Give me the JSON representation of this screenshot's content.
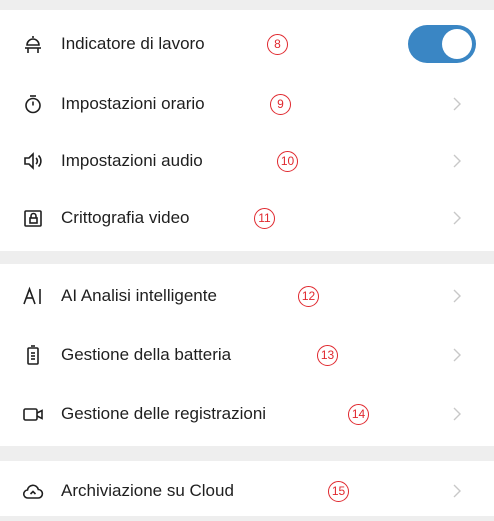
{
  "colors": {
    "accent": "#3a86c4",
    "annotation": "#e0282e",
    "section_gap": "#eeeeee"
  },
  "groups": [
    {
      "items": [
        {
          "label": "Indicatore di lavoro",
          "badge": "8",
          "icon": "work-indicator-icon",
          "control": "toggle",
          "toggle_on": true
        },
        {
          "label": "Impostazioni orario",
          "badge": "9",
          "icon": "timer-icon",
          "control": "chevron"
        },
        {
          "label": "Impostazioni audio",
          "badge": "10",
          "icon": "speaker-icon",
          "control": "chevron"
        },
        {
          "label": "Crittografia video",
          "badge": "11",
          "icon": "lock-icon",
          "control": "chevron"
        }
      ]
    },
    {
      "items": [
        {
          "label": "AI Analisi intelligente",
          "badge": "12",
          "icon": "ai-icon",
          "control": "chevron"
        },
        {
          "label": "Gestione della batteria",
          "badge": "13",
          "icon": "battery-icon",
          "control": "chevron"
        },
        {
          "label": "Gestione delle registrazioni",
          "badge": "14",
          "icon": "camera-icon",
          "control": "chevron"
        }
      ]
    },
    {
      "items": [
        {
          "label": "Archiviazione su Cloud",
          "badge": "15",
          "icon": "cloud-icon",
          "control": "chevron"
        }
      ]
    }
  ]
}
